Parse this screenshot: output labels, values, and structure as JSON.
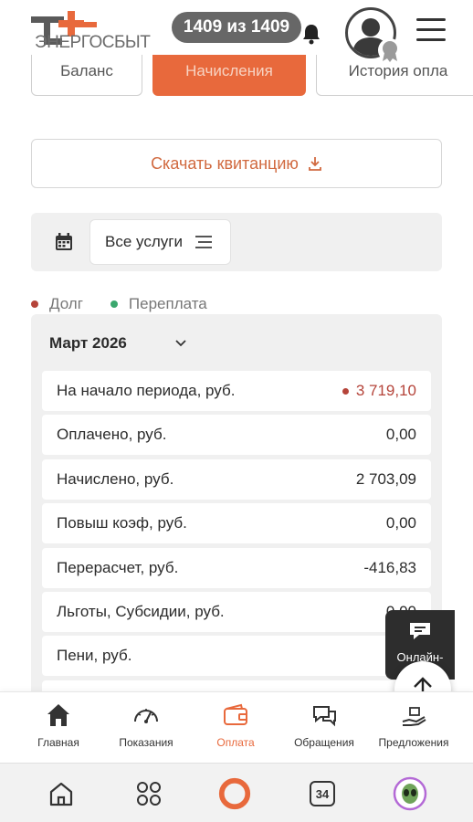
{
  "header": {
    "logo_text": "ЭНЕРГОСБЫТ",
    "counter": "1409 из 1409"
  },
  "tabs": [
    {
      "label": "Баланс",
      "active": false
    },
    {
      "label": "Начисления",
      "active": true
    },
    {
      "label": "История опла",
      "active": false
    }
  ],
  "download_button": {
    "label": "Скачать квитанцию"
  },
  "filter": {
    "services_label": "Все услуги"
  },
  "legend": {
    "debt_label": "Долг",
    "debt_color": "#b5443a",
    "overpay_label": "Переплата",
    "overpay_color": "#3aa76d"
  },
  "period": {
    "title": "Март 2026",
    "rows": [
      {
        "label": "На начало периода, руб.",
        "value": "3 719,10"
      },
      {
        "label": "Оплачено, руб.",
        "value": "0,00"
      },
      {
        "label": "Начислено, руб.",
        "value": "2 703,09"
      },
      {
        "label": "Повыш коэф, руб.",
        "value": "0,00"
      },
      {
        "label": "Перерасчет, руб.",
        "value": "-416,83"
      },
      {
        "label": "Льготы, Субсидии, руб.",
        "value": "0,00"
      },
      {
        "label": "Пени, руб.",
        "value": ""
      }
    ]
  },
  "chat": {
    "label": "Онлайн-"
  },
  "bottom_nav": [
    {
      "label": "Главная"
    },
    {
      "label": "Показания"
    },
    {
      "label": "Оплата"
    },
    {
      "label": "Обращения"
    },
    {
      "label": "Предложения"
    }
  ],
  "system_bar": {
    "tabs_count": "34"
  },
  "colors": {
    "accent": "#e8693c",
    "debt": "#b5443a",
    "overpay": "#3aa76d"
  }
}
